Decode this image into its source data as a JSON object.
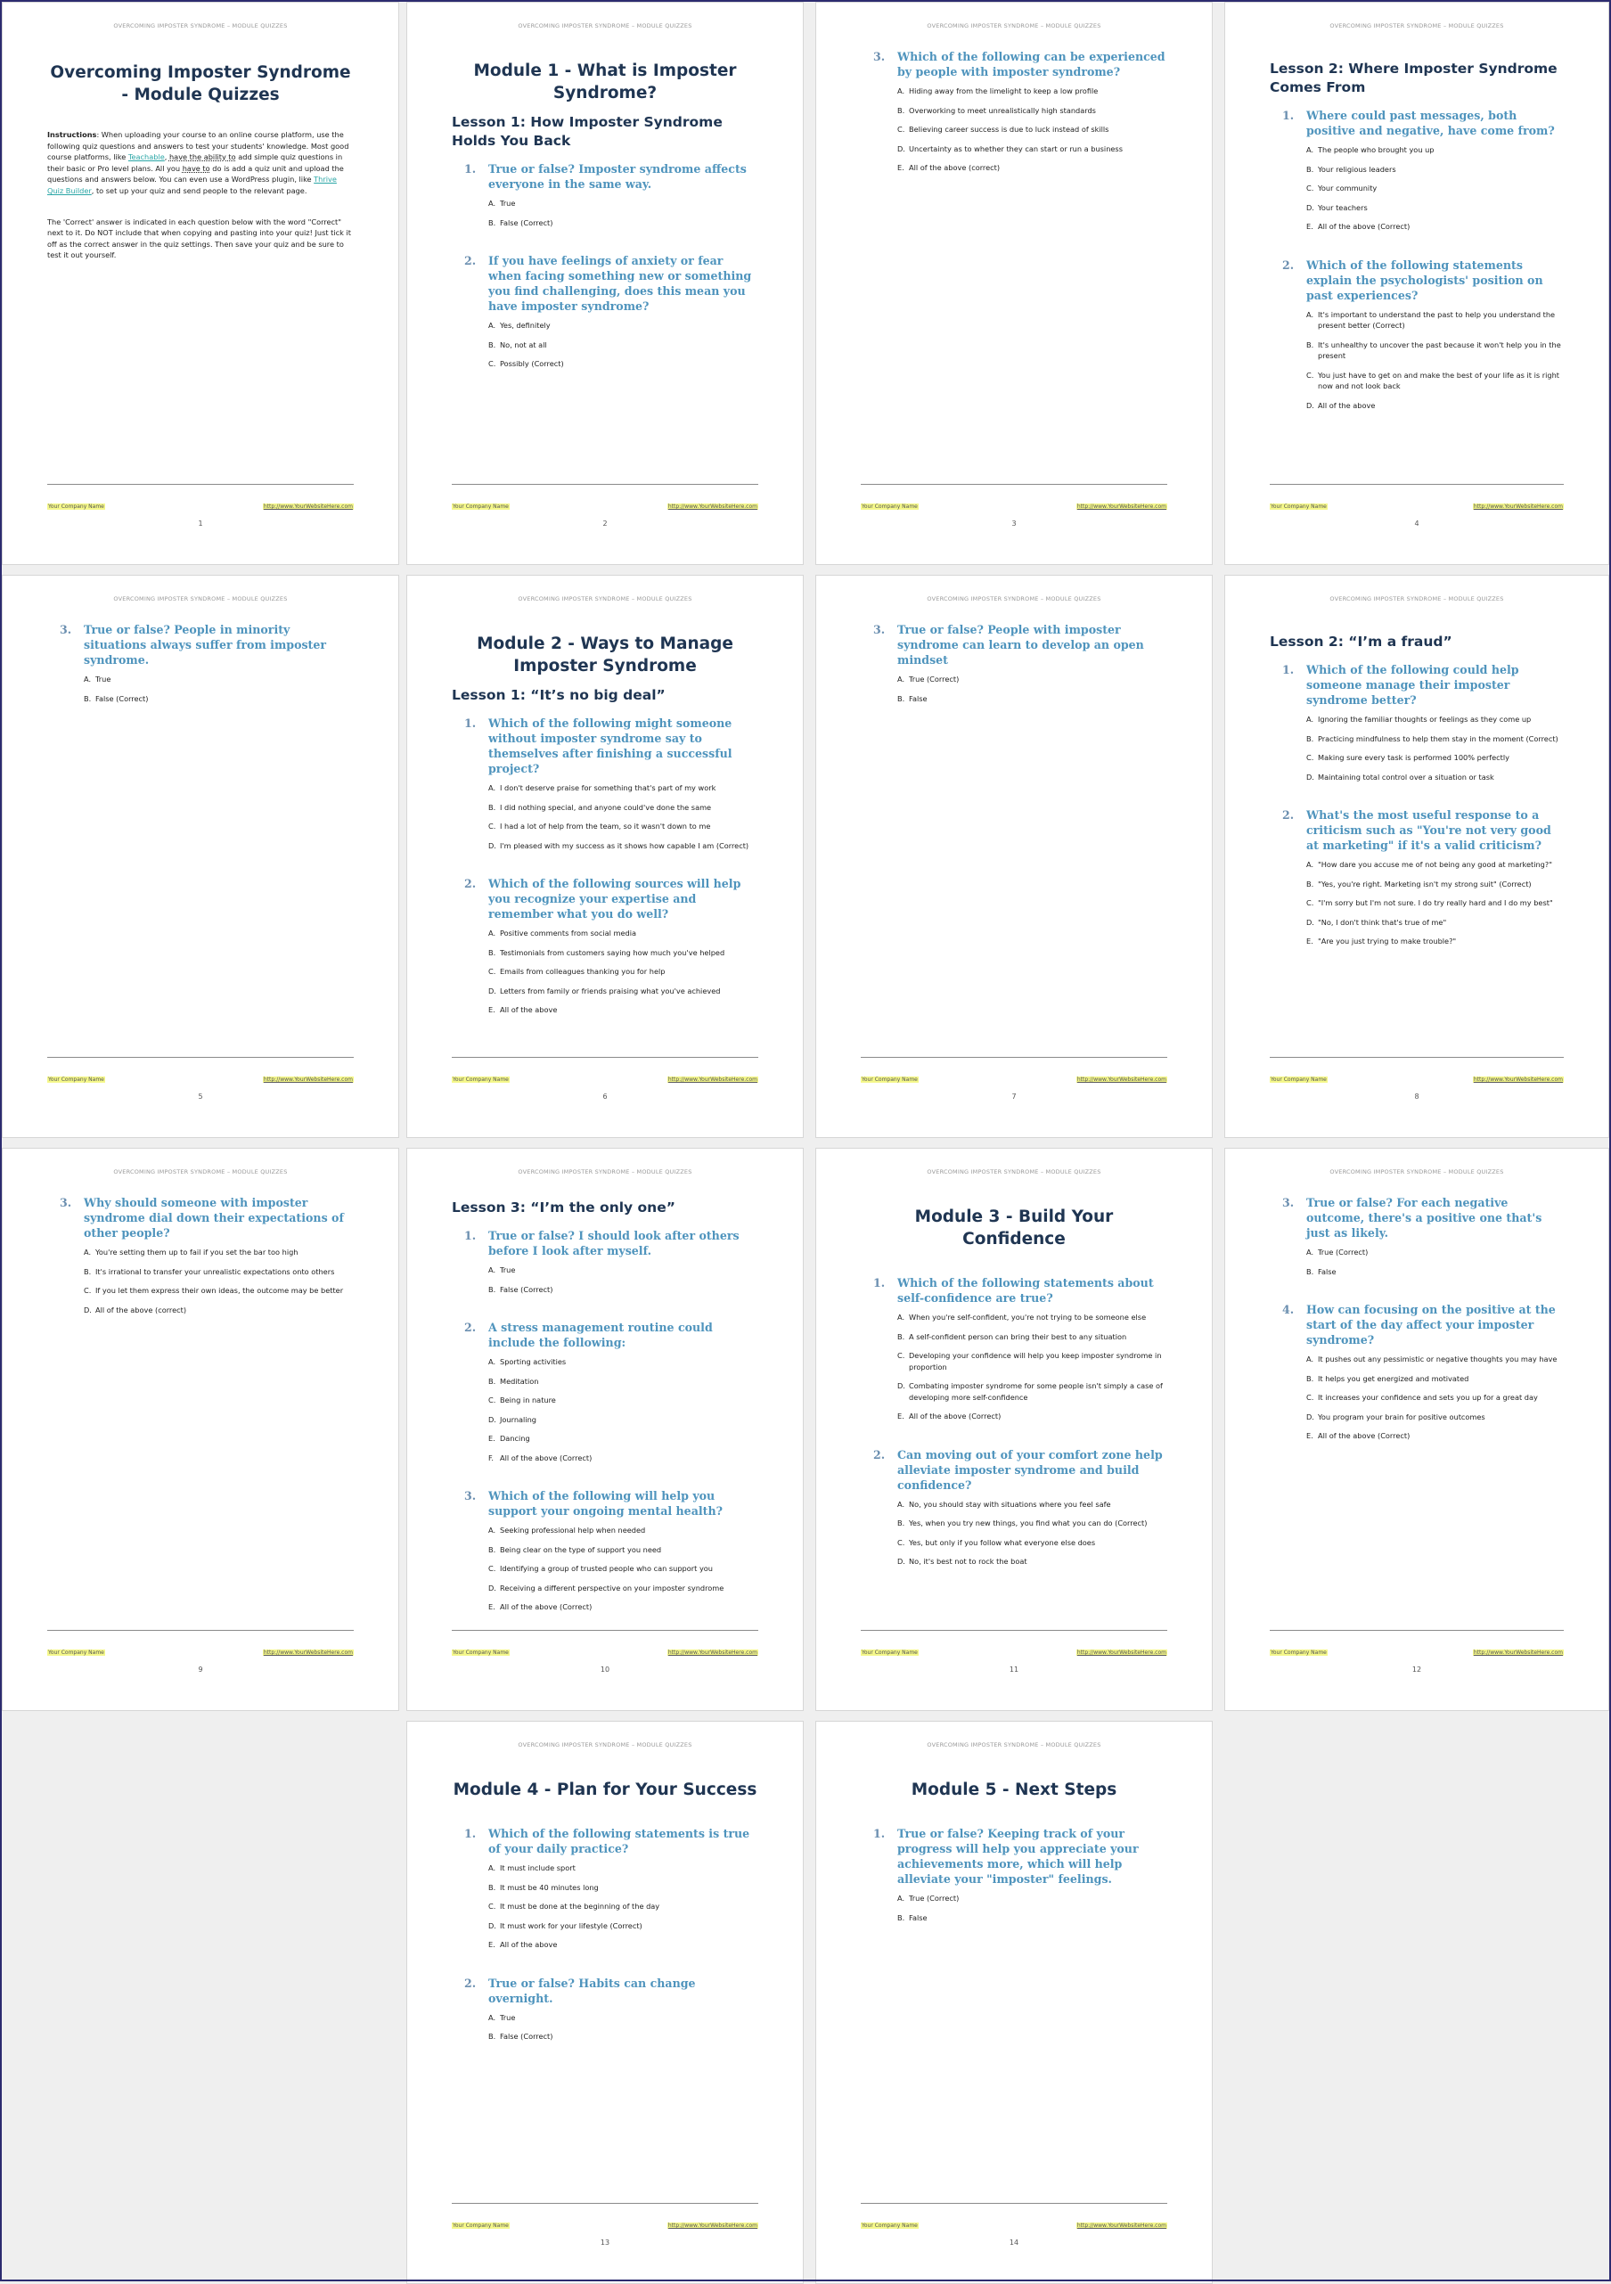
{
  "document": {
    "running_header": "OVERCOMING IMPOSTER SYNDROME – MODULE QUIZZES",
    "footer_company": "Your Company Name",
    "footer_url": "http://www.YourWebsiteHere.com"
  },
  "pages": [
    {
      "number": "1",
      "title": "Overcoming Imposter Syndrome - Module Quizzes",
      "instructions": {
        "label": "Instructions",
        "p1_a": ": When uploading your course to an online course platform, use the following quiz questions and answers to test your students' knowledge. Most good course platforms, like ",
        "link1": "Teachable",
        "p1_b": ", ",
        "ul1": "have the ability to",
        "p1_c": " add simple quiz questions in their basic or Pro level plans. All you ",
        "ul2": "have to",
        "p1_d": " do is add a quiz unit and upload the questions and answers below. You can even use a WordPress plugin, like ",
        "link2": "Thrive Quiz Builder",
        "p1_e": ", to set up your quiz and send people to the relevant page.",
        "p2": "The 'Correct' answer is indicated in each question below with the word \"Correct\" next to it. Do NOT include that when copying and pasting into your quiz! Just tick it off as the correct answer in the quiz settings. Then save your quiz and be sure to test it out yourself."
      }
    },
    {
      "number": "2",
      "title": "Module 1 - What is Imposter Syndrome?",
      "lesson": "Lesson 1: How Imposter Syndrome Holds You Back",
      "questions": [
        {
          "num": "1.",
          "text": "True or false? Imposter syndrome affects everyone in the same way.",
          "options": [
            {
              "l": "A.",
              "t": "True"
            },
            {
              "l": "B.",
              "t": "False (Correct)"
            }
          ]
        },
        {
          "num": "2.",
          "text": "If you have feelings of anxiety or fear when facing something new or something you find challenging, does this mean you have imposter syndrome?",
          "options": [
            {
              "l": "A.",
              "t": "Yes, definitely"
            },
            {
              "l": "B.",
              "t": "No, not at all"
            },
            {
              "l": "C.",
              "t": "Possibly (Correct)"
            }
          ]
        }
      ]
    },
    {
      "number": "3",
      "questions": [
        {
          "num": "3.",
          "text": "Which of the following can be experienced by people with imposter syndrome?",
          "options": [
            {
              "l": "A.",
              "t": "Hiding away from the limelight to keep a low profile"
            },
            {
              "l": "B.",
              "t": "Overworking to meet unrealistically high standards"
            },
            {
              "l": "C.",
              "t": "Believing career success is due to luck instead of skills"
            },
            {
              "l": "D.",
              "t": "Uncertainty as to whether they can start or run a business"
            },
            {
              "l": "E.",
              "t": "All of the above (correct)"
            }
          ]
        }
      ]
    },
    {
      "number": "4",
      "lesson": "Lesson 2: Where Imposter Syndrome Comes From",
      "questions": [
        {
          "num": "1.",
          "text": "Where could past messages, both positive and negative, have come from?",
          "options": [
            {
              "l": "A.",
              "t": "The people who brought you up"
            },
            {
              "l": "B.",
              "t": "Your religious leaders"
            },
            {
              "l": "C.",
              "t": "Your community"
            },
            {
              "l": "D.",
              "t": "Your teachers"
            },
            {
              "l": "E.",
              "t": "All of the above (Correct)"
            }
          ]
        },
        {
          "num": "2.",
          "text": "Which of the following statements explain the psychologists' position on past experiences?",
          "options": [
            {
              "l": "A.",
              "t": "It's important to understand the past to help you understand the present better (Correct)"
            },
            {
              "l": "B.",
              "t": "It's unhealthy to uncover the past because it won't help you in the present"
            },
            {
              "l": "C.",
              "t": "You just have to get on and make the best of your life as it is right now and not look back"
            },
            {
              "l": "D.",
              "t": "All of the above"
            }
          ]
        }
      ]
    },
    {
      "number": "5",
      "questions": [
        {
          "num": "3.",
          "text": "True or false? People in minority situations always suffer from imposter syndrome.",
          "options": [
            {
              "l": "A.",
              "t": "True"
            },
            {
              "l": "B.",
              "t": "False (Correct)"
            }
          ]
        }
      ]
    },
    {
      "number": "6",
      "title": "Module 2 - Ways to Manage Imposter Syndrome",
      "lesson": "Lesson 1: “It’s no big deal”",
      "questions": [
        {
          "num": "1.",
          "text": "Which of the following might someone without imposter syndrome say to themselves after finishing a successful project?",
          "options": [
            {
              "l": "A.",
              "t": "I don't deserve praise for something that's part of my work"
            },
            {
              "l": "B.",
              "t": "I did nothing special, and anyone could've done the same"
            },
            {
              "l": "C.",
              "t": "I had a lot of help from the team, so it wasn't down to me"
            },
            {
              "l": "D.",
              "t": "I'm pleased with my success as it shows how capable I am (Correct)"
            }
          ]
        },
        {
          "num": "2.",
          "text": "Which of the following sources will help you recognize your expertise and remember what you do well?",
          "options": [
            {
              "l": "A.",
              "t": "Positive comments from social media"
            },
            {
              "l": "B.",
              "t": "Testimonials from customers saying how much you've helped"
            },
            {
              "l": "C.",
              "t": "Emails from colleagues thanking you for help"
            },
            {
              "l": "D.",
              "t": "Letters from family or friends praising what you've achieved"
            },
            {
              "l": "E.",
              "t": "All of the above"
            }
          ]
        }
      ]
    },
    {
      "number": "7",
      "questions": [
        {
          "num": "3.",
          "text": "True or false?  People with imposter syndrome can learn to develop an open mindset",
          "options": [
            {
              "l": "A.",
              "t": "True (Correct)"
            },
            {
              "l": "B.",
              "t": "False"
            }
          ]
        }
      ]
    },
    {
      "number": "8",
      "lesson": "Lesson 2: “I’m a fraud”",
      "questions": [
        {
          "num": "1.",
          "text": "Which of the following could help someone manage their imposter syndrome better?",
          "options": [
            {
              "l": "A.",
              "t": "Ignoring the familiar thoughts or feelings as they come up"
            },
            {
              "l": "B.",
              "t": "Practicing mindfulness to help them stay in the moment (Correct)"
            },
            {
              "l": "C.",
              "t": "Making sure every task is performed 100% perfectly"
            },
            {
              "l": "D.",
              "t": "Maintaining total control over a situation or task"
            }
          ]
        },
        {
          "num": "2.",
          "text": "What's the most useful response to a criticism such as \"You're not very good at marketing\" if it's a valid criticism?",
          "options": [
            {
              "l": "A.",
              "t": "\"How dare you accuse me of not being any good at marketing?\""
            },
            {
              "l": "B.",
              "t": "\"Yes, you're right. Marketing isn't my strong suit\" (Correct)"
            },
            {
              "l": "C.",
              "t": "\"I'm sorry but I'm not sure. I do try really hard and I do my best\""
            },
            {
              "l": "D.",
              "t": "\"No, I don't think that's true of me\""
            },
            {
              "l": "E.",
              "t": "\"Are you just trying to make trouble?\""
            }
          ]
        }
      ]
    },
    {
      "number": "9",
      "questions": [
        {
          "num": "3.",
          "text": "Why should someone with imposter syndrome dial down their expectations of other people?",
          "options": [
            {
              "l": "A.",
              "t": "You're setting them up to fail if you set the bar too high"
            },
            {
              "l": "B.",
              "t": "It's irrational to transfer your unrealistic expectations onto others"
            },
            {
              "l": "C.",
              "t": "If you let them express their own ideas, the outcome may be better"
            },
            {
              "l": "D.",
              "t": "All of the above (correct)"
            }
          ]
        }
      ]
    },
    {
      "number": "10",
      "lesson": "Lesson 3: “I’m the only one”",
      "questions": [
        {
          "num": "1.",
          "text": "True or false?  I should look after others before I look after myself.",
          "options": [
            {
              "l": "A.",
              "t": "True"
            },
            {
              "l": "B.",
              "t": "False (Correct)"
            }
          ]
        },
        {
          "num": "2.",
          "text": "A stress management routine could include the following:",
          "options": [
            {
              "l": "A.",
              "t": "Sporting activities"
            },
            {
              "l": "B.",
              "t": "Meditation"
            },
            {
              "l": "C.",
              "t": "Being in nature"
            },
            {
              "l": "D.",
              "t": "Journaling"
            },
            {
              "l": "E.",
              "t": "Dancing"
            },
            {
              "l": "F.",
              "t": "All of the above (Correct)"
            }
          ]
        },
        {
          "num": "3.",
          "text": "Which of the following will help you support your ongoing mental health?",
          "options": [
            {
              "l": "A.",
              "t": "Seeking professional help when needed"
            },
            {
              "l": "B.",
              "t": "Being clear on the type of support you need"
            },
            {
              "l": "C.",
              "t": "Identifying a group of trusted people who can support you"
            },
            {
              "l": "D.",
              "t": "Receiving a different perspective on your imposter syndrome"
            },
            {
              "l": "E.",
              "t": "All of the above (Correct)"
            }
          ]
        }
      ]
    },
    {
      "number": "11",
      "title": "Module 3 - Build Your Confidence",
      "questions": [
        {
          "num": "1.",
          "text": "Which of the following statements about self-confidence are true?",
          "options": [
            {
              "l": "A.",
              "t": "When you're self-confident, you're not trying to be someone else"
            },
            {
              "l": "B.",
              "t": "A self-confident person can bring their best to any situation"
            },
            {
              "l": "C.",
              "t": "Developing your confidence will help you keep imposter syndrome in proportion"
            },
            {
              "l": "D.",
              "t": "Combating imposter syndrome for some people isn't simply a case of developing more self-confidence"
            },
            {
              "l": "E.",
              "t": "All of the above (Correct)"
            }
          ]
        },
        {
          "num": "2.",
          "text": "Can moving out of your comfort zone help alleviate imposter syndrome and build confidence?",
          "options": [
            {
              "l": "A.",
              "t": "No, you should stay with situations where you feel safe"
            },
            {
              "l": "B.",
              "t": "Yes, when you try new things, you find what you can do (Correct)"
            },
            {
              "l": "C.",
              "t": "Yes, but only if you follow what everyone else does"
            },
            {
              "l": "D.",
              "t": "No, it's best not to rock the boat"
            }
          ]
        }
      ]
    },
    {
      "number": "12",
      "questions": [
        {
          "num": "3.",
          "text": "True or false? For each negative outcome, there's a positive one that's just as likely.",
          "options": [
            {
              "l": "A.",
              "t": "True (Correct)"
            },
            {
              "l": "B.",
              "t": "False"
            }
          ]
        },
        {
          "num": "4.",
          "text": "How can focusing on the positive at the start of the day affect your imposter syndrome?",
          "options": [
            {
              "l": "A.",
              "t": "It pushes out any pessimistic or negative thoughts you may have"
            },
            {
              "l": "B.",
              "t": "It helps you get energized and motivated"
            },
            {
              "l": "C.",
              "t": "It increases your confidence and sets you up for a great day"
            },
            {
              "l": "D.",
              "t": "You program your brain for positive outcomes"
            },
            {
              "l": "E.",
              "t": "All of the above (Correct)"
            }
          ]
        }
      ]
    },
    {
      "number": "13",
      "title": "Module 4 - Plan for Your Success",
      "questions": [
        {
          "num": "1.",
          "text": "Which of the following statements is true of your daily practice?",
          "options": [
            {
              "l": "A.",
              "t": "It must include sport"
            },
            {
              "l": "B.",
              "t": "It must be 40 minutes long"
            },
            {
              "l": "C.",
              "t": "It must be done at the beginning of the day"
            },
            {
              "l": "D.",
              "t": "It must work for your lifestyle (Correct)"
            },
            {
              "l": "E.",
              "t": "All of the above"
            }
          ]
        },
        {
          "num": "2.",
          "text": "True or false? Habits can change overnight.",
          "options": [
            {
              "l": "A.",
              "t": "True"
            },
            {
              "l": "B.",
              "t": "False (Correct)"
            }
          ]
        }
      ]
    },
    {
      "number": "14",
      "title": "Module 5 - Next Steps",
      "questions": [
        {
          "num": "1.",
          "text": "True or false? Keeping track of your progress will help you appreciate your achievements more, which will help alleviate your \"imposter\" feelings.",
          "options": [
            {
              "l": "A.",
              "t": "True (Correct)"
            },
            {
              "l": "B.",
              "t": "False"
            }
          ]
        }
      ]
    }
  ]
}
